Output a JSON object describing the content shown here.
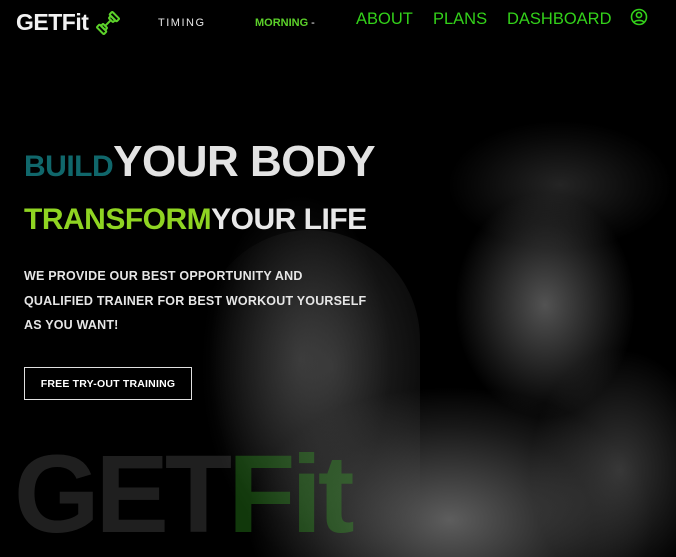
{
  "brand": {
    "name": "GETFit",
    "icon": "dumbbell-icon",
    "icon_color": "#5cd12a"
  },
  "nav": {
    "timing_label": "TIMING",
    "timing_value": "MORNING",
    "timing_dash": "-",
    "links": [
      "ABOUT",
      "PLANS",
      "DASHBOARD"
    ],
    "user_icon": "user-circle-icon"
  },
  "hero": {
    "headline1_accent": "BUILD",
    "headline1_rest": "YOUR BODY",
    "headline2_accent": "TRANSFORM",
    "headline2_rest": "YOUR LIFE",
    "subtext": "WE PROVIDE OUR BEST OPPORTUNITY AND QUALIFIED TRAINER FOR BEST WORKOUT YOURSELF AS YOU WANT!",
    "cta_label": "FREE TRY-OUT TRAINING"
  },
  "watermark": {
    "part1": "GET",
    "part2": "Fit"
  },
  "colors": {
    "accent_green": "#33d11a",
    "lime": "#8fd422",
    "teal": "#10676b",
    "background": "#000000"
  }
}
